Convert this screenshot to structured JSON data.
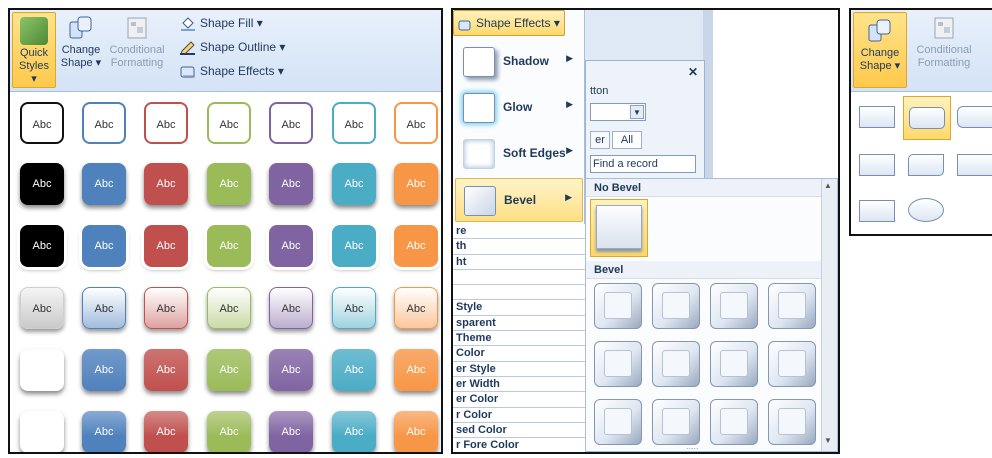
{
  "panel_left": {
    "buttons": {
      "quick_styles": "Quick Styles ▾",
      "change_shape": "Change Shape ▾",
      "conditional_formatting": "Conditional Formatting"
    },
    "commands": {
      "fill": "Shape Fill ▾",
      "outline": "Shape Outline ▾",
      "effects": "Shape Effects ▾"
    },
    "swatch_label": "Abc",
    "colors": [
      "#ffffff",
      "#4f81bd",
      "#c0504d",
      "#9bbb59",
      "#8064a2",
      "#4bacc6",
      "#f79646"
    ]
  },
  "panel_middle": {
    "menu_title": "Shape Effects ▾",
    "items": [
      {
        "label": "Shadow"
      },
      {
        "label": "Glow"
      },
      {
        "label": "Soft Edges"
      },
      {
        "label": "Bevel"
      }
    ],
    "bg_texts": {
      "close": "✕",
      "ton": "tton",
      "tab_er": "er",
      "tab_all": "All",
      "find": "Find a record"
    },
    "props": [
      "re",
      "th",
      "ht",
      "",
      "",
      "Style",
      "sparent",
      "Theme",
      "Color",
      "er Style",
      "er Width",
      "er Color",
      "r Color",
      "sed Color",
      "r Fore Color"
    ],
    "no_bevel": "No Bevel",
    "bevel": "Bevel",
    "grip": "....."
  },
  "panel_right": {
    "change_shape": "Change Shape ▾",
    "conditional_formatting": "Conditional Formatting"
  }
}
